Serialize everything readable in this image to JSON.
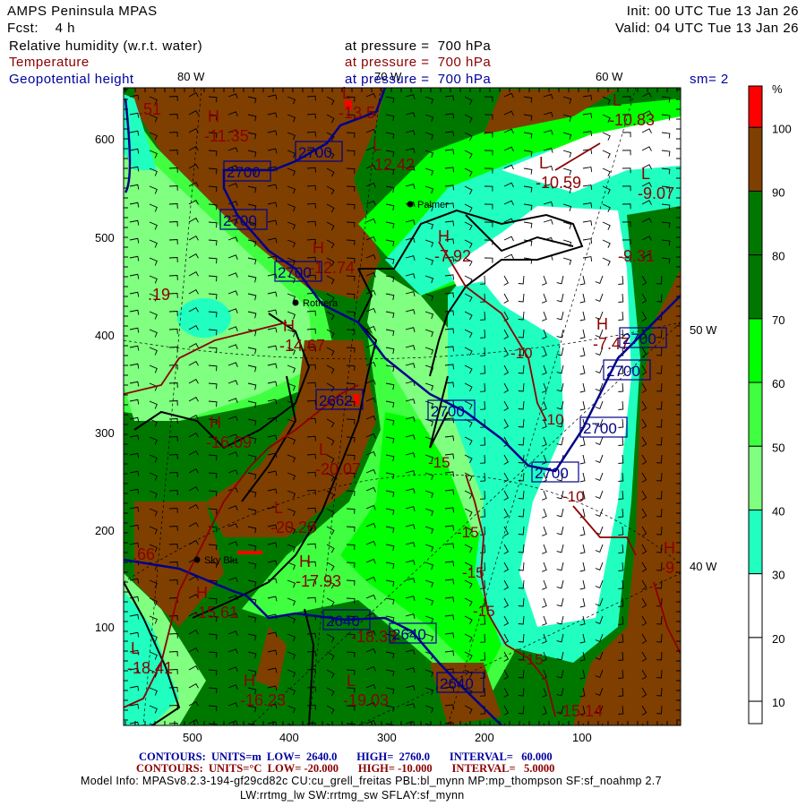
{
  "header": {
    "title": "AMPS Peninsula MPAS",
    "forecast": "Fcst:    4 h",
    "init": "Init: 00 UTC Tue 13 Jan 26",
    "valid": "Valid: 04 UTC Tue 13 Jan 26",
    "fields": [
      {
        "name": "Relative humidity (w.r.t. water)",
        "level": "at pressure =  700 hPa",
        "color": "#000000"
      },
      {
        "name": "Temperature",
        "level": "at pressure =  700 hPa",
        "color": "#8b0000"
      },
      {
        "name": "Geopotential height",
        "level": "at pressure =  700 hPa",
        "color": "#0000a0"
      }
    ],
    "smoothing": "sm= 2"
  },
  "map": {
    "longitude_labels": [
      "80 W",
      "70 W",
      "60 W",
      "50 W",
      "40 W"
    ],
    "y_ticks": [
      "600",
      "500",
      "400",
      "300",
      "200",
      "100"
    ],
    "x_ticks": [
      "500",
      "400",
      "300",
      "200",
      "100"
    ],
    "stations": [
      "Palmer",
      "Rothera",
      "Sky Blu"
    ],
    "temperature_extrema": [
      {
        "type": "H",
        "value": "-11.35"
      },
      {
        "type": "L",
        "value": "-13.5"
      },
      {
        "type": "L",
        "value": "-12.42"
      },
      {
        "type": "H",
        "value": "-12.74"
      },
      {
        "type": "H",
        "value": "-14.67"
      },
      {
        "type": "H",
        "value": "-16.09"
      },
      {
        "type": "L",
        "value": "-20.07"
      },
      {
        "type": "L",
        "value": "-20.28"
      },
      {
        "type": "H",
        "value": "-17.93"
      },
      {
        "type": "H",
        "value": "-15.61"
      },
      {
        "type": "L",
        "value": "-18.41"
      },
      {
        "type": "H",
        "value": "-16.23"
      },
      {
        "type": "L",
        "value": "-19.03"
      },
      {
        "type": "L",
        "value": "-10.83"
      },
      {
        "type": "L",
        "value": "-10.59"
      },
      {
        "type": "L",
        "value": "-9.07"
      },
      {
        "type": "H",
        "value": "-7.92"
      },
      {
        "type": "H",
        "value": "-7.47"
      },
      {
        "type": "H",
        "value": "-9."
      },
      {
        "type": "",
        "value": "-9.31"
      },
      {
        "type": "",
        "value": "-18.33"
      },
      {
        "type": "",
        "value": "-15.14"
      },
      {
        "type": "",
        "value": ".51"
      },
      {
        "type": "",
        "value": ".19"
      },
      {
        "type": "",
        "value": ".66"
      }
    ],
    "temperature_contour_labels": [
      "-10",
      "-10",
      "-10",
      "-15",
      "-15",
      "-15",
      "-15",
      "-15"
    ],
    "height_contour_labels": [
      "2700",
      "2700",
      "2700",
      "2700",
      "2700",
      "2700",
      "2700",
      "2700",
      "2700",
      "2662",
      "2640",
      "2640",
      "2640"
    ]
  },
  "colorbar": {
    "unit": "%",
    "labels": [
      "100",
      "90",
      "80",
      "70",
      "60",
      "50",
      "40",
      "30",
      "20",
      "10"
    ],
    "colors": [
      "#ff0000",
      "#7f3f00",
      "#007800",
      "#007800",
      "#00ff00",
      "#40ff40",
      "#80ff80",
      "#20ffc0",
      "#ffffff",
      "#ffffff",
      "#ffffff"
    ]
  },
  "footer": {
    "height_contours": "CONTOURS:  UNITS=m  LOW=  2640.0       HIGH=  2760.0       INTERVAL=   60.000",
    "temp_contours": "CONTOURS:  UNITS=°C  LOW= -20.000       HIGH= -10.000       INTERVAL=   5.0000",
    "model_info": "Model Info: MPASv8.2.3-194-gf29cd82c CU:cu_grell_freitas PBL:bl_mynn MP:mp_thompson SF:sf_noahmp 2.7",
    "model_info_2": "LW:rrtmg_lw SW:rrtmg_sw SFLAY:sf_mynn"
  }
}
